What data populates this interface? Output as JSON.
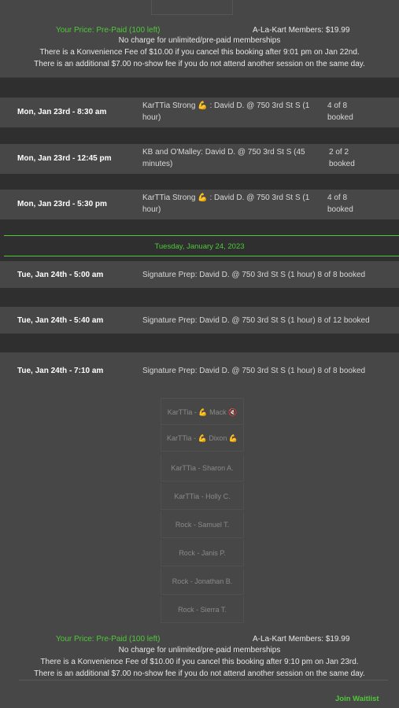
{
  "top_info": {
    "price": "Your Price: Pre-Paid (100 left)",
    "members": "A-La-Kart Members: $19.99",
    "no_charge": "No charge for unlimited/pre-paid memberships",
    "fee": "There is a Konvenience Fee of $10.00 if you cancel this booking after 9:01 pm on Jan 22nd.",
    "no_show": "There is an additional $7.00 no-show fee if you do not attend another session on the same day."
  },
  "sessions_jan23": [
    {
      "date": "Mon, Jan 23rd - 8:30 am",
      "desc1": "KarTTia Strong 💪 : David D. @ 750 3rd St S (1",
      "desc2": "hour)",
      "booked1": "4 of 8",
      "booked2": "booked"
    },
    {
      "date": "Mon, Jan 23rd - 12:45 pm",
      "desc1": "KB and O'Malley: David D. @ 750 3rd St S (45",
      "desc2": "minutes)",
      "booked1": "2 of 2",
      "booked2": "booked"
    },
    {
      "date": "Mon, Jan 23rd - 5:30 pm",
      "desc1": "KarTTia Strong 💪 : David D. @ 750 3rd St S (1",
      "desc2": "hour)",
      "booked1": "4 of 8",
      "booked2": "booked"
    }
  ],
  "day_header": "Tuesday, January 24, 2023",
  "sessions_jan24": [
    {
      "date": "Tue, Jan 24th - 5:00 am",
      "desc": "Signature Prep: David D. @ 750 3rd St S (1 hour) 8 of 8 booked"
    },
    {
      "date": "Tue, Jan 24th - 5:40 am",
      "desc": "Signature Prep: David D. @ 750 3rd St S (1 hour) 8 of 12 booked"
    },
    {
      "date": "Tue, Jan 24th - 7:10 am",
      "desc": "Signature Prep: David D. @ 750 3rd St S (1 hour) 8 of 8 booked"
    }
  ],
  "attendees": [
    "KarTTia - 💪 Mack 🔇",
    "KarTTia - 💪 Dixon 💪",
    "KarTTia - Sharon A.",
    "KarTTia - Holly C.",
    "Rock - Samuel T.",
    "Rock - Janis P.",
    "Rock - Jonathan B.",
    "Rock - Sierra T."
  ],
  "bottom_info": {
    "price": "Your Price: Pre-Paid (100 left)",
    "members": "A-La-Kart Members: $19.99",
    "no_charge": "No charge for unlimited/pre-paid memberships",
    "fee": "There is a Konvenience Fee of $10.00 if you cancel this booking after 9:10 pm on Jan 23rd.",
    "no_show": "There is an additional $7.00 no-show fee if you do not attend another session on the same day."
  },
  "join_waitlist": "Join Waitlist",
  "colors": {
    "accent": "#4fc83a",
    "band": "#474747",
    "background": "#2f2f2f"
  }
}
